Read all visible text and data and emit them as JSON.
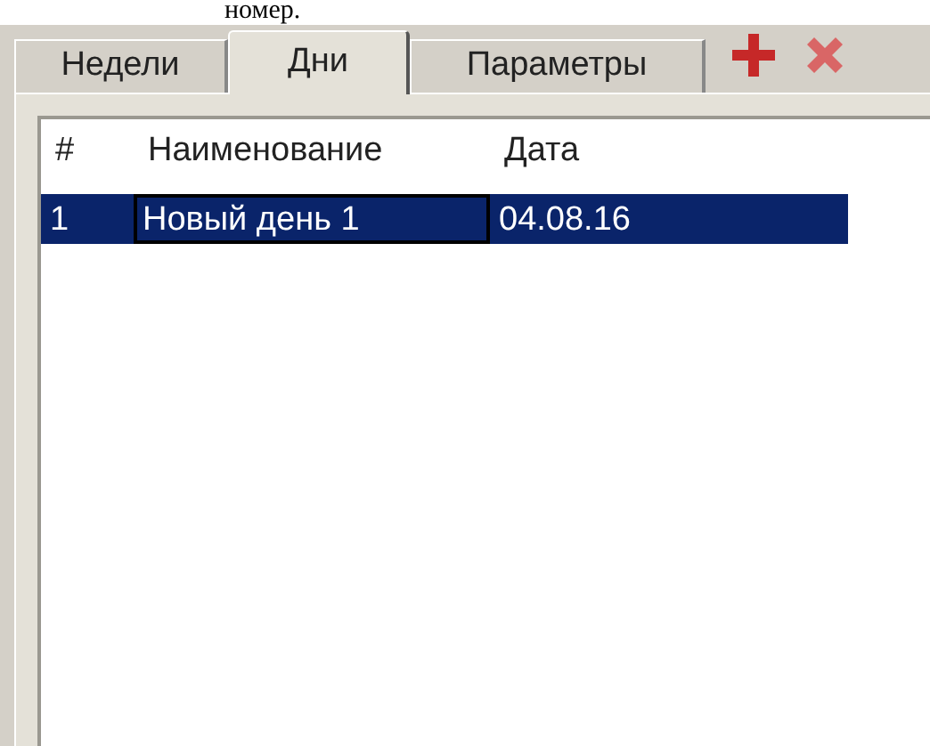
{
  "caption": "номер.",
  "tabs": [
    {
      "label": "Недели",
      "selected": false
    },
    {
      "label": "Дни",
      "selected": true
    },
    {
      "label": "Параметры",
      "selected": false
    }
  ],
  "table": {
    "columns": [
      "#",
      "Наименование",
      "Дата"
    ],
    "rows": [
      {
        "cells": [
          "1",
          "Новый день 1",
          "04.08.16"
        ],
        "selected": true
      }
    ]
  }
}
